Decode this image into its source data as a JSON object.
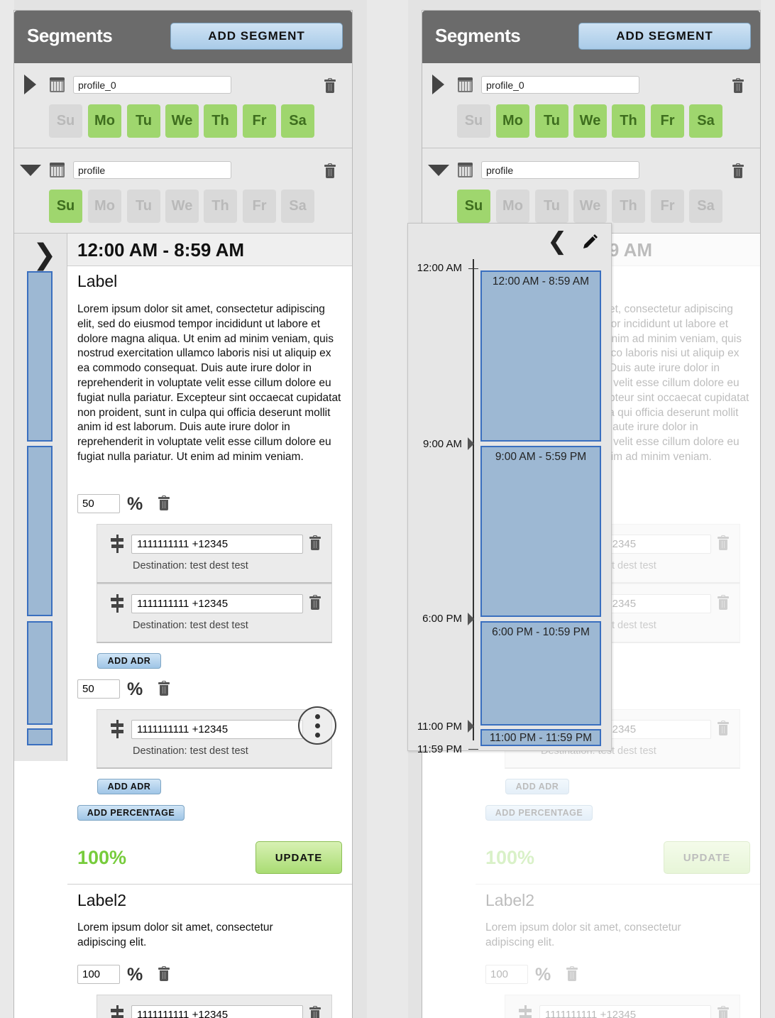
{
  "header": {
    "title": "Segments",
    "add_segment": "ADD SEGMENT"
  },
  "profiles": [
    {
      "name": "profile_0",
      "expanded": false,
      "days": [
        {
          "label": "Su",
          "on": false
        },
        {
          "label": "Mo",
          "on": true
        },
        {
          "label": "Tu",
          "on": true
        },
        {
          "label": "We",
          "on": true
        },
        {
          "label": "Th",
          "on": true
        },
        {
          "label": "Fr",
          "on": true
        },
        {
          "label": "Sa",
          "on": true
        }
      ]
    },
    {
      "name": "profile",
      "expanded": true,
      "days": [
        {
          "label": "Su",
          "on": true
        },
        {
          "label": "Mo",
          "on": false
        },
        {
          "label": "Tu",
          "on": false
        },
        {
          "label": "We",
          "on": false
        },
        {
          "label": "Th",
          "on": false
        },
        {
          "label": "Fr",
          "on": false
        },
        {
          "label": "Sa",
          "on": false
        }
      ]
    }
  ],
  "segment": {
    "time_range": "12:00 AM - 8:59 AM",
    "label": "Label",
    "description": "Lorem ipsum dolor sit amet, consectetur adipiscing elit, sed do eiusmod tempor incididunt ut labore et dolore magna aliqua. Ut enim ad minim veniam, quis nostrud exercitation ullamco laboris nisi ut aliquip ex ea commodo consequat. Duis aute irure dolor in reprehenderit in voluptate velit esse cillum dolore eu fugiat nulla pariatur. Excepteur sint occaecat cupidatat non proident, sunt in culpa qui officia deserunt mollit anim id est laborum. Duis aute irure dolor in reprehenderit in voluptate velit esse cillum dolore eu fugiat nulla pariatur. Ut enim ad minim veniam.",
    "percentages": [
      {
        "value": "50",
        "adrs": [
          {
            "number": "1111111111 +12345",
            "destination": "Destination: test dest test"
          },
          {
            "number": "1111111111 +12345",
            "destination": "Destination: test dest test"
          }
        ]
      },
      {
        "value": "50",
        "adrs": [
          {
            "number": "1111111111 +12345",
            "destination": "Destination: test dest test"
          }
        ]
      }
    ],
    "percent_sign": "%",
    "add_adr": "ADD ADR",
    "add_percentage": "ADD PERCENTAGE",
    "total": "100%",
    "update": "UPDATE"
  },
  "segment2": {
    "label": "Label2",
    "description": "Lorem ipsum dolor sit amet, consectetur adipiscing elit.",
    "percentage": "100",
    "adr_number": "1111111111 +12345"
  },
  "timeline": {
    "ticks": [
      "12:00 AM",
      "9:00 AM",
      "6:00 PM",
      "11:00 PM",
      "11:59 PM"
    ],
    "blocks": [
      "12:00 AM - 8:59 AM",
      "9:00 AM - 5:59 PM",
      "6:00 PM - 10:59 PM",
      "11:00 PM - 11:59 PM"
    ]
  },
  "colors": {
    "header": "#6b6b6b",
    "day_on": "#9fd66e",
    "accent_blue": "#9db8d3",
    "total_green": "#77cc3c"
  }
}
